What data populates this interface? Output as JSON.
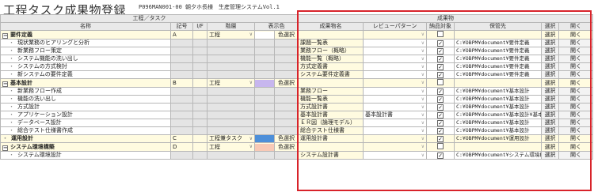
{
  "window": {
    "title": "工程タスク成果物登録",
    "subtitle": "P096MAN001-00 朝夕ホ長様　生産管理システムVol.1"
  },
  "header": {
    "group_task": "工程／タスク",
    "group_deliv": "成果物",
    "col_name": "名称",
    "col_kigo": "記号",
    "col_if": "I/F",
    "col_level": "階層",
    "col_color": "表示色",
    "col_deliv_name": "成果物名",
    "col_review": "レビューパターン",
    "col_nohin": "納品対象",
    "col_path": "保管先",
    "col_select": "選択",
    "col_open": "開く"
  },
  "rows": [
    {
      "type": "grp",
      "name": "要件定義",
      "kigo": "A",
      "level": "工程",
      "color": "#ffffff",
      "color_btn": "色選択",
      "deliv": "",
      "review": "",
      "path": "",
      "checked": false,
      "open": "選択",
      "open2": "開く"
    },
    {
      "type": "sub",
      "name": "現状業務のヒアリングと分析",
      "kigo": "",
      "level": "",
      "color": "",
      "color_btn": "",
      "deliv": "課題一覧表",
      "review": "",
      "path": "C:¥OBPM¥document¥要件定義",
      "checked": true,
      "open": "選択",
      "open2": "開く"
    },
    {
      "type": "sub",
      "name": "新業務フロー策定",
      "kigo": "",
      "level": "",
      "color": "",
      "color_btn": "",
      "deliv": "業務フロー（概略）",
      "review": "",
      "path": "C:¥OBPM¥document¥要件定義",
      "checked": true,
      "open": "選択",
      "open2": "開く"
    },
    {
      "type": "sub",
      "name": "システム機能の洗い出し",
      "kigo": "",
      "level": "",
      "color": "",
      "color_btn": "",
      "deliv": "機能一覧（概略）",
      "review": "",
      "path": "C:¥OBPM¥document¥要件定義",
      "checked": true,
      "open": "選択",
      "open2": "開く"
    },
    {
      "type": "sub",
      "name": "システムの方式検討",
      "kigo": "",
      "level": "",
      "color": "",
      "color_btn": "",
      "deliv": "方式定義書",
      "review": "",
      "path": "C:¥OBPM¥document¥要件定義",
      "checked": true,
      "open": "選択",
      "open2": "開く"
    },
    {
      "type": "sub",
      "name": "新システムの要件定義",
      "kigo": "",
      "level": "",
      "color": "",
      "color_btn": "",
      "deliv": "システム要件定義書",
      "review": "",
      "path": "C:¥OBPM¥document¥要件定義",
      "checked": true,
      "open": "選択",
      "open2": "開く"
    },
    {
      "type": "grp",
      "name": "基本設計",
      "kigo": "B",
      "level": "工程",
      "color": "#c7b6ee",
      "color_btn": "色選択",
      "deliv": "",
      "review": "",
      "path": "",
      "checked": false,
      "open": "選択",
      "open2": "開く"
    },
    {
      "type": "sub",
      "name": "新業務フロー作成",
      "kigo": "",
      "level": "",
      "color": "",
      "color_btn": "",
      "deliv": "業務フロー",
      "review": "",
      "path": "C:¥OBPM¥document¥基本設計",
      "checked": true,
      "open": "選択",
      "open2": "開く"
    },
    {
      "type": "sub",
      "name": "機能の洗い出し",
      "kigo": "",
      "level": "",
      "color": "",
      "color_btn": "",
      "deliv": "機能一覧表",
      "review": "",
      "path": "C:¥OBPM¥document¥基本設計",
      "checked": true,
      "open": "選択",
      "open2": "開く"
    },
    {
      "type": "sub",
      "name": "方式設計",
      "kigo": "",
      "level": "",
      "color": "",
      "color_btn": "",
      "deliv": "方式設計書",
      "review": "",
      "path": "C:¥OBPM¥document¥基本設計",
      "checked": true,
      "open": "選択",
      "open2": "開く"
    },
    {
      "type": "sub",
      "name": "アプリケーション設計",
      "kigo": "",
      "level": "",
      "color": "",
      "color_btn": "",
      "deliv": "基本設計書",
      "review": "基本設計書",
      "path": "C:¥OBPM¥document¥基本設計¥基本設計",
      "checked": true,
      "open": "選択",
      "open2": "開く"
    },
    {
      "type": "sub",
      "name": "データベース設計",
      "kigo": "",
      "level": "",
      "color": "",
      "color_btn": "",
      "deliv": "ＥＲ図（論理モデル）",
      "review": "",
      "path": "C:¥OBPM¥document¥基本設計",
      "checked": true,
      "open": "選択",
      "open2": "開く"
    },
    {
      "type": "sub",
      "name": "総合テスト仕様書作成",
      "kigo": "",
      "level": "",
      "color": "",
      "color_btn": "",
      "deliv": "総合テスト仕様書",
      "review": "",
      "path": "C:¥OBPM¥document¥基本設計",
      "checked": true,
      "open": "選択",
      "open2": "開く"
    },
    {
      "type": "grp2",
      "name": "運用設計",
      "kigo": "C",
      "level": "工程兼タスク",
      "color": "#4d8fd9",
      "color_btn": "色選択",
      "deliv": "運用設計書",
      "review": "",
      "path": "C:¥OBPM¥document¥運用設計",
      "checked": true,
      "open": "選択",
      "open2": "開く"
    },
    {
      "type": "grp",
      "name": "システム環境構築",
      "kigo": "D",
      "level": "工程",
      "color": "#f8c9b6",
      "color_btn": "色選択",
      "deliv": "",
      "review": "",
      "path": "",
      "checked": false,
      "open": "選択",
      "open2": "開く"
    },
    {
      "type": "sub",
      "name": "システム環境設計",
      "kigo": "",
      "level": "",
      "color": "",
      "color_btn": "",
      "deliv": "システム設計書",
      "review": "",
      "path": "C:¥OBPM¥document¥システム環境構築",
      "checked": true,
      "open": "選択",
      "open2": "開く"
    }
  ]
}
